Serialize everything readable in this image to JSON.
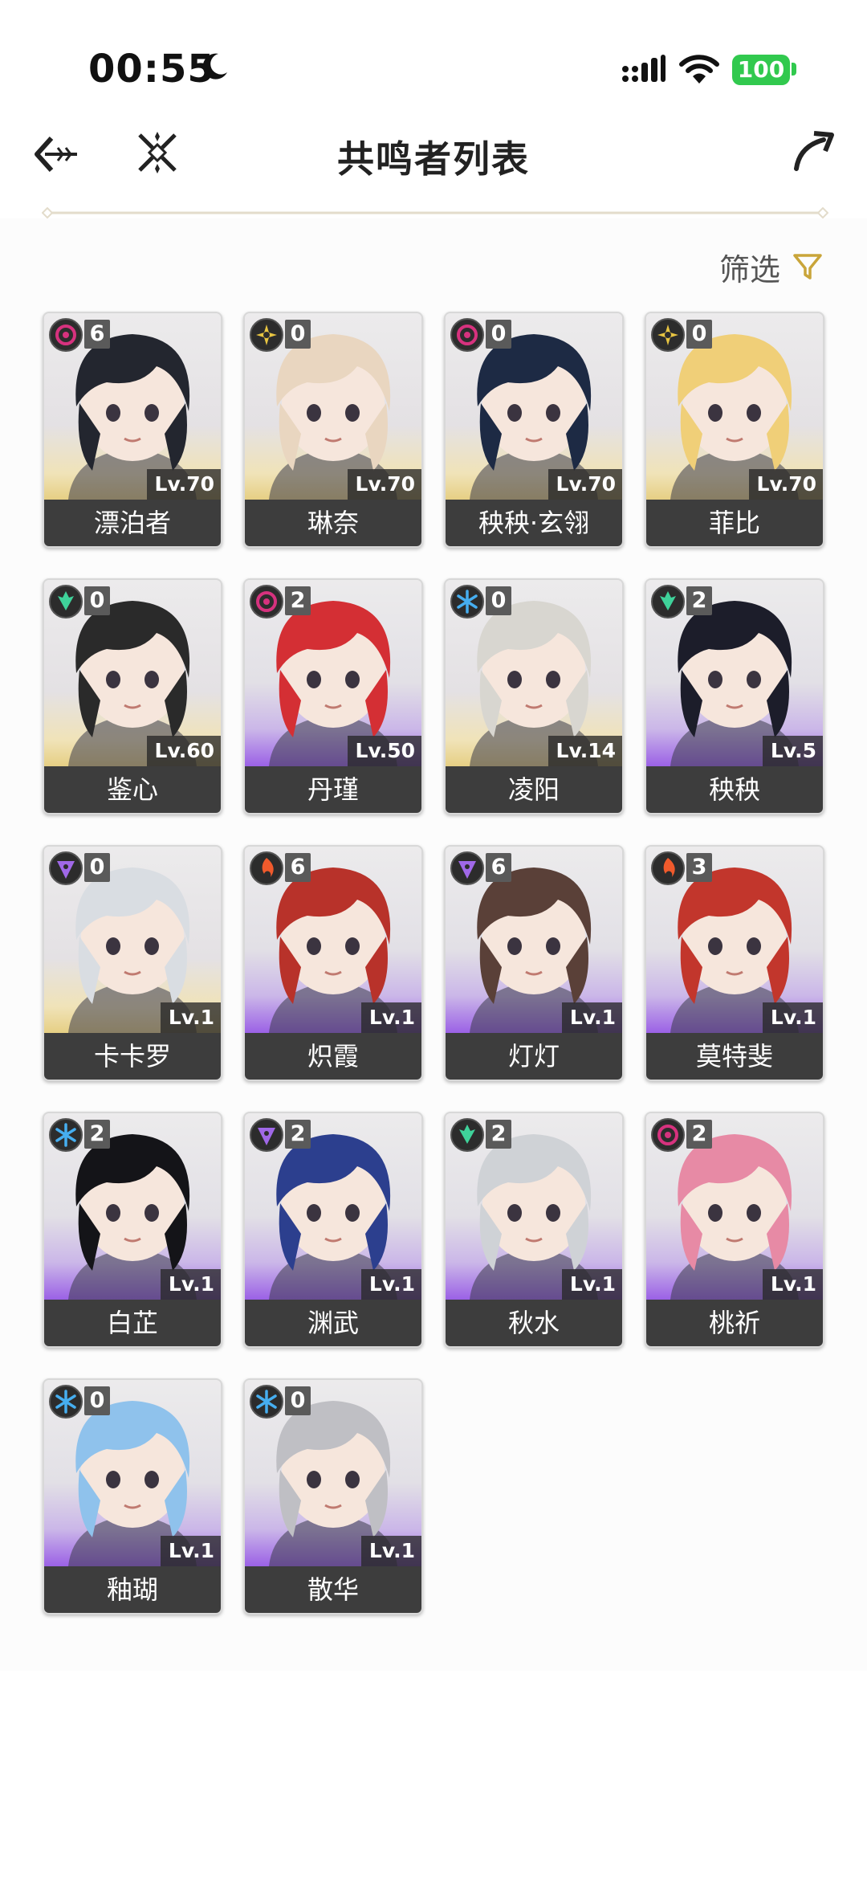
{
  "status_bar": {
    "time": "00:55",
    "battery": "100"
  },
  "header": {
    "title": "共鸣者列表"
  },
  "filter": {
    "label": "筛选"
  },
  "element_colors": {
    "havoc": "#d6327e",
    "spectro": "#e8c542",
    "aero": "#3fd29a",
    "glacio": "#46aef0",
    "electro": "#a068e8",
    "fusion": "#f05a2c"
  },
  "resonators": [
    {
      "name": "漂泊者",
      "level": "Lv.70",
      "sequence": "6",
      "element": "havoc",
      "rarity": 5,
      "hair": "#23262f"
    },
    {
      "name": "琳奈",
      "level": "Lv.70",
      "sequence": "0",
      "element": "spectro",
      "rarity": 5,
      "hair": "#e9d6c0"
    },
    {
      "name": "秧秧·玄翎",
      "level": "Lv.70",
      "sequence": "0",
      "element": "havoc",
      "rarity": 5,
      "hair": "#1d2a44"
    },
    {
      "name": "菲比",
      "level": "Lv.70",
      "sequence": "0",
      "element": "spectro",
      "rarity": 5,
      "hair": "#f0cf78"
    },
    {
      "name": "鉴心",
      "level": "Lv.60",
      "sequence": "0",
      "element": "aero",
      "rarity": 5,
      "hair": "#2a2a2a"
    },
    {
      "name": "丹瑾",
      "level": "Lv.50",
      "sequence": "2",
      "element": "havoc",
      "rarity": 4,
      "hair": "#d42f34"
    },
    {
      "name": "凌阳",
      "level": "Lv.14",
      "sequence": "0",
      "element": "glacio",
      "rarity": 5,
      "hair": "#d8d6d0"
    },
    {
      "name": "秧秧",
      "level": "Lv.5",
      "sequence": "2",
      "element": "aero",
      "rarity": 4,
      "hair": "#1c1d2a"
    },
    {
      "name": "卡卡罗",
      "level": "Lv.1",
      "sequence": "0",
      "element": "electro",
      "rarity": 5,
      "hair": "#d9dde2"
    },
    {
      "name": "炽霞",
      "level": "Lv.1",
      "sequence": "6",
      "element": "fusion",
      "rarity": 4,
      "hair": "#b8322a"
    },
    {
      "name": "灯灯",
      "level": "Lv.1",
      "sequence": "6",
      "element": "electro",
      "rarity": 4,
      "hair": "#5a4038"
    },
    {
      "name": "莫特斐",
      "level": "Lv.1",
      "sequence": "3",
      "element": "fusion",
      "rarity": 4,
      "hair": "#c2362c"
    },
    {
      "name": "白芷",
      "level": "Lv.1",
      "sequence": "2",
      "element": "glacio",
      "rarity": 4,
      "hair": "#141418"
    },
    {
      "name": "渊武",
      "level": "Lv.1",
      "sequence": "2",
      "element": "electro",
      "rarity": 4,
      "hair": "#2c3f8e"
    },
    {
      "name": "秋水",
      "level": "Lv.1",
      "sequence": "2",
      "element": "aero",
      "rarity": 4,
      "hair": "#cfd2d6"
    },
    {
      "name": "桃祈",
      "level": "Lv.1",
      "sequence": "2",
      "element": "havoc",
      "rarity": 4,
      "hair": "#e78aa5"
    },
    {
      "name": "釉瑚",
      "level": "Lv.1",
      "sequence": "0",
      "element": "glacio",
      "rarity": 4,
      "hair": "#8fc2ec"
    },
    {
      "name": "散华",
      "level": "Lv.1",
      "sequence": "0",
      "element": "glacio",
      "rarity": 4,
      "hair": "#bfbfc4"
    }
  ]
}
